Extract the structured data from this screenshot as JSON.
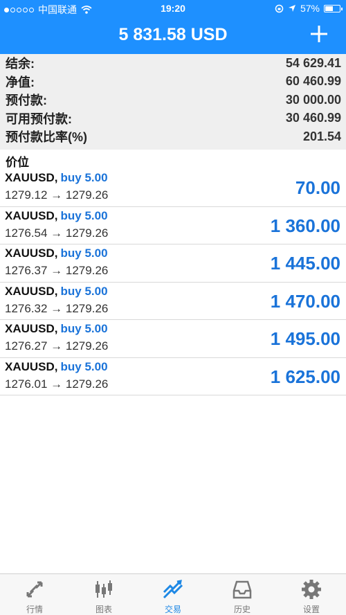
{
  "status": {
    "carrier": "中国联通",
    "time": "19:20",
    "battery": "57%",
    "battery_level": 0.57
  },
  "header": {
    "title": "5 831.58 USD",
    "plus_icon": "plus-icon"
  },
  "summary": [
    {
      "label": "结余:",
      "value": "54 629.41"
    },
    {
      "label": "净值:",
      "value": "60 460.99"
    },
    {
      "label": "预付款:",
      "value": "30 000.00"
    },
    {
      "label": "可用预付款:",
      "value": "30 460.99"
    },
    {
      "label": "预付款比率(%)",
      "value": "201.54"
    }
  ],
  "section_title": "价位",
  "positions": [
    {
      "symbol": "XAUUSD,",
      "side": "buy 5.00",
      "prices": "1279.12 → 1279.26",
      "profit": "70.00"
    },
    {
      "symbol": "XAUUSD,",
      "side": "buy 5.00",
      "prices": "1276.54 → 1279.26",
      "profit": "1 360.00"
    },
    {
      "symbol": "XAUUSD,",
      "side": "buy 5.00",
      "prices": "1276.37 → 1279.26",
      "profit": "1 445.00"
    },
    {
      "symbol": "XAUUSD,",
      "side": "buy 5.00",
      "prices": "1276.32 → 1279.26",
      "profit": "1 470.00"
    },
    {
      "symbol": "XAUUSD,",
      "side": "buy 5.00",
      "prices": "1276.27 → 1279.26",
      "profit": "1 495.00"
    },
    {
      "symbol": "XAUUSD,",
      "side": "buy 5.00",
      "prices": "1276.01 → 1279.26",
      "profit": "1 625.00"
    }
  ],
  "tabs": [
    {
      "label": "行情",
      "icon": "arrows-icon",
      "active": false
    },
    {
      "label": "图表",
      "icon": "candlestick-icon",
      "active": false
    },
    {
      "label": "交易",
      "icon": "trend-icon",
      "active": true
    },
    {
      "label": "历史",
      "icon": "inbox-icon",
      "active": false
    },
    {
      "label": "设置",
      "icon": "gear-icon",
      "active": false
    }
  ],
  "colors": {
    "header": "#1e90ff",
    "accent": "#1a73d9",
    "summary_bg": "#efefef"
  }
}
